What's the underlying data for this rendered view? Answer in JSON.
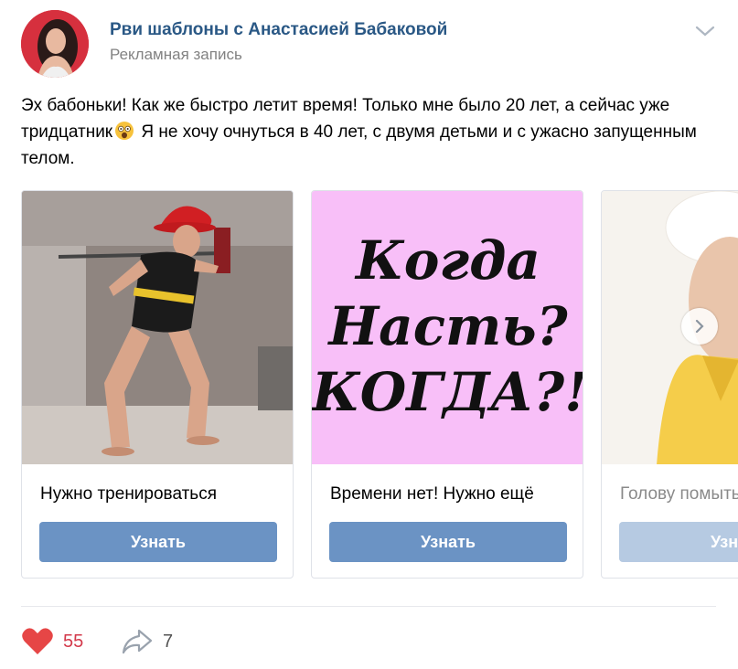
{
  "post": {
    "author": "Рви шаблоны с Анастасией Бабаковой",
    "meta": "Рекламная запись",
    "text_before_emoji": "Эх бабоньки! Как же быстро летит время! Только мне было 20 лет, а сейчас уже тридцатник",
    "text_after_emoji": " Я не хочу очнуться в 40 лет, с двумя детьми и с ужасно запущенным телом.",
    "emoji": "astonished-face-icon"
  },
  "cards": [
    {
      "title": "Нужно тренироваться",
      "button": "Узнать"
    },
    {
      "title": "Времени нет! Нужно ещё",
      "button": "Узнать",
      "poster_lines": [
        "Когда",
        "Насть?",
        "КОГДА?!"
      ]
    },
    {
      "title": "Голову помыть",
      "button": "Узнать"
    }
  ],
  "footer": {
    "likes": "55",
    "shares": "7"
  },
  "colors": {
    "link": "#2a5885",
    "button": "#6b93c4",
    "like": "#d3394b",
    "poster_bg": "#f8bff8"
  }
}
